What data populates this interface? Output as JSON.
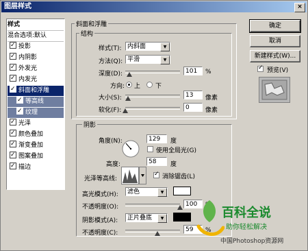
{
  "window": {
    "title": "图层样式",
    "close": "×"
  },
  "left_list": {
    "header": "样式",
    "blend": "混合选项:默认",
    "items": [
      {
        "label": "投影",
        "checked": true
      },
      {
        "label": "内阴影",
        "checked": true
      },
      {
        "label": "外发光",
        "checked": true
      },
      {
        "label": "内发光",
        "checked": true
      },
      {
        "label": "斜面和浮雕",
        "checked": true
      },
      {
        "label": "等高线",
        "checked": true
      },
      {
        "label": "纹理",
        "checked": true
      },
      {
        "label": "光泽",
        "checked": true
      },
      {
        "label": "颜色叠加",
        "checked": true
      },
      {
        "label": "渐变叠加",
        "checked": true
      },
      {
        "label": "图案叠加",
        "checked": true
      },
      {
        "label": "描边",
        "checked": true
      }
    ]
  },
  "bevel": {
    "group_title": "斜面和浮雕",
    "structure_title": "结构",
    "style_label": "样式(T):",
    "style_value": "内斜面",
    "technique_label": "方法(Q):",
    "technique_value": "平滑",
    "depth_label": "深度(D):",
    "depth_value": "101",
    "depth_unit": "%",
    "direction_label": "方向:",
    "dir_up": "上",
    "dir_down": "下",
    "size_label": "大小(S):",
    "size_value": "13",
    "size_unit": "像素",
    "soften_label": "软化(F):",
    "soften_value": "0",
    "soften_unit": "像素"
  },
  "shading": {
    "title": "阴影",
    "angle_label": "角度(N):",
    "angle_value": "129",
    "angle_unit": "度",
    "global_light": "使用全局光(G)",
    "altitude_label": "高度:",
    "altitude_value": "58",
    "altitude_unit": "度",
    "gloss_label": "光泽等高线:",
    "antialias": "消除锯齿(L)",
    "highlight_label": "高光模式(H):",
    "highlight_value": "滤色",
    "highlight_color": "#ffffff",
    "hl_opacity_label": "不透明度(O):",
    "hl_opacity_value": "100",
    "hl_opacity_unit": "%",
    "shadow_label": "阴影模式(A):",
    "shadow_value": "正片叠底",
    "shadow_color": "#000000",
    "sh_opacity_label": "不透明度(C):",
    "sh_opacity_value": "59",
    "sh_opacity_unit": "%"
  },
  "buttons": {
    "ok": "确定",
    "cancel": "取消",
    "new_style": "新建样式(W)...",
    "preview": "预览(V)"
  },
  "watermark": {
    "brand": "百科全说",
    "tagline": "助你轻松解决",
    "site": "中国Photoshop资源网"
  }
}
